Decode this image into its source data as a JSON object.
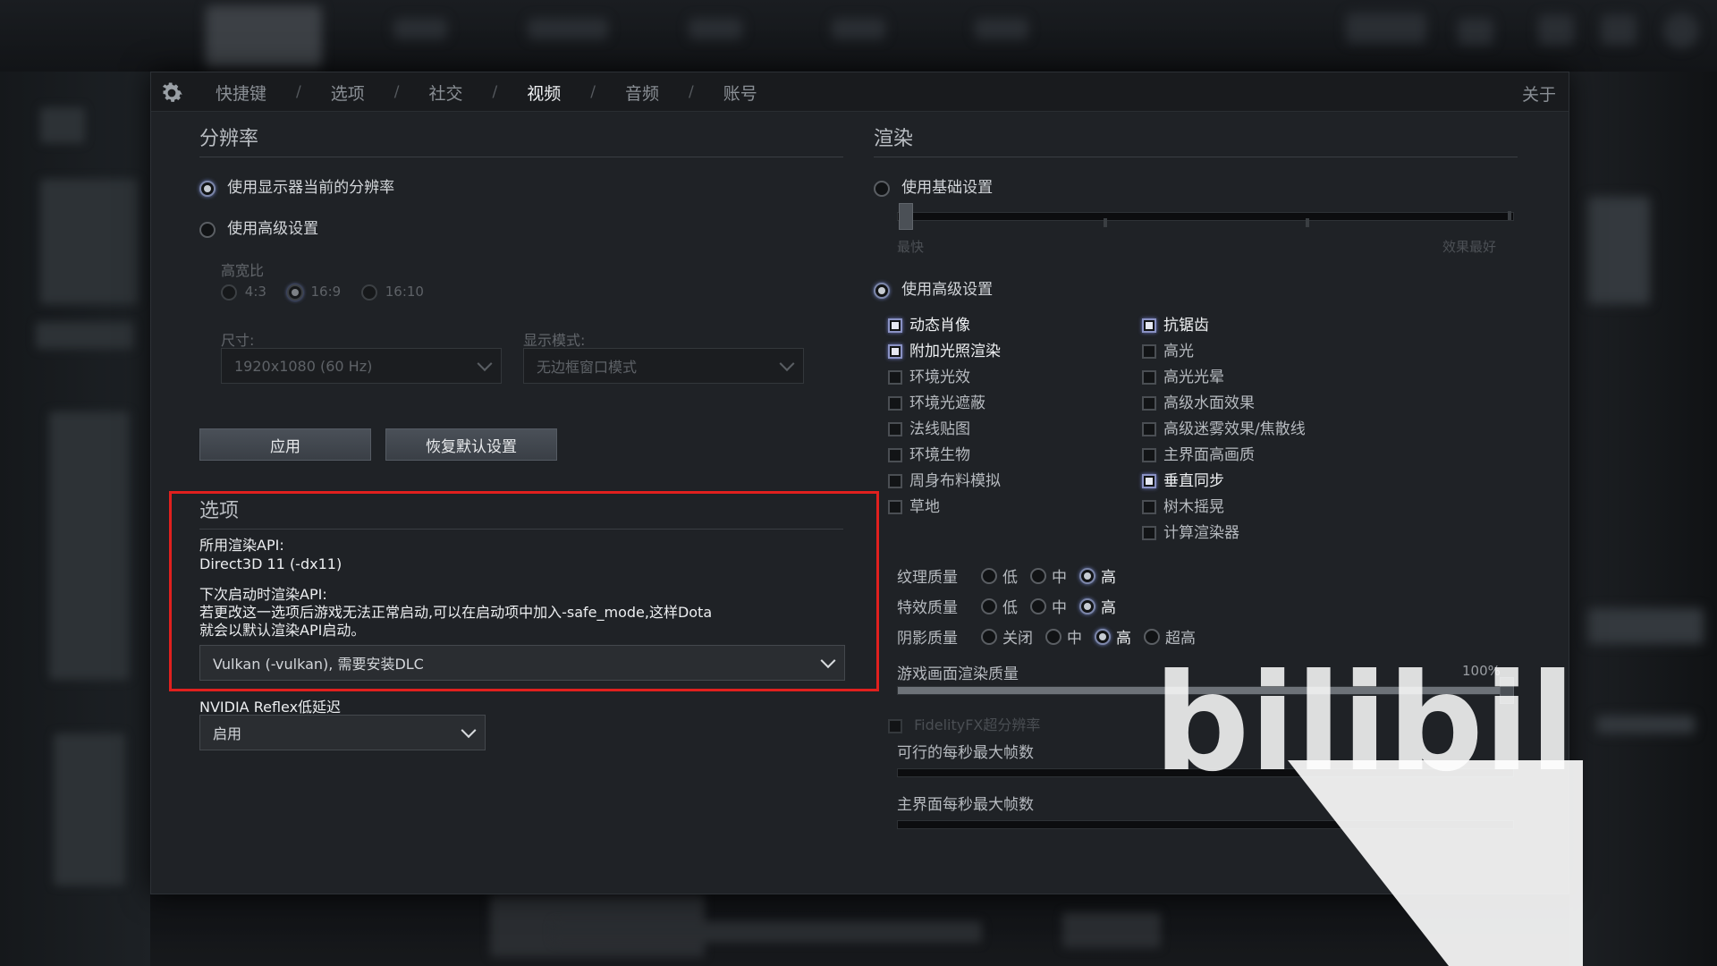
{
  "tabs": [
    "快捷键",
    "选项",
    "社交",
    "视频",
    "音频",
    "账号"
  ],
  "tab_separator": "/",
  "active_tab": "视频",
  "about": "关于",
  "resolution": {
    "title": "分辨率",
    "use_monitor": "使用显示器当前的分辨率",
    "use_advanced": "使用高级设置",
    "aspect_label": "高宽比",
    "aspect_options": [
      "4:3",
      "16:9",
      "16:10"
    ],
    "aspect_selected": "16:9",
    "size_label": "尺寸:",
    "size_value": "1920x1080 (60 Hz)",
    "display_mode_label": "显示模式:",
    "display_mode_value": "无边框窗口模式",
    "apply_button": "应用",
    "restore_button": "恢复默认设置"
  },
  "options": {
    "title": "选项",
    "api_label": "所用渲染API:",
    "api_value": "Direct3D 11 (-dx11)",
    "next_api_label": "下次启动时渲染API:",
    "next_api_note_1": "若更改这一选项后游戏无法正常启动,可以在启动项中加入-safe_mode,这样Dota",
    "next_api_note_2": "就会以默认渲染API启动。",
    "api_select": "Vulkan (-vulkan), 需要安装DLC",
    "reflex_label": "NVIDIA Reflex低延迟",
    "reflex_value": "启用"
  },
  "render": {
    "title": "渲染",
    "use_basic": "使用基础设置",
    "slider_left": "最快",
    "slider_right": "效果最好",
    "use_advanced": "使用高级设置",
    "left_checks": [
      {
        "label": "动态肖像",
        "checked": true
      },
      {
        "label": "附加光照渲染",
        "checked": true
      },
      {
        "label": "环境光效",
        "checked": false
      },
      {
        "label": "环境光遮蔽",
        "checked": false
      },
      {
        "label": "法线贴图",
        "checked": false
      },
      {
        "label": "环境生物",
        "checked": false
      },
      {
        "label": "周身布料模拟",
        "checked": false
      },
      {
        "label": "草地",
        "checked": false
      }
    ],
    "right_checks": [
      {
        "label": "抗锯齿",
        "checked": true
      },
      {
        "label": "高光",
        "checked": false
      },
      {
        "label": "高光光晕",
        "checked": false
      },
      {
        "label": "高级水面效果",
        "checked": false
      },
      {
        "label": "高级迷雾效果/焦散线",
        "checked": false
      },
      {
        "label": "主界面高画质",
        "checked": false
      },
      {
        "label": "垂直同步",
        "checked": true
      },
      {
        "label": "树木摇晃",
        "checked": false
      },
      {
        "label": "计算渲染器",
        "checked": false
      }
    ],
    "texture": {
      "label": "纹理质量",
      "options": [
        "低",
        "中",
        "高"
      ],
      "selected": "高"
    },
    "effects": {
      "label": "特效质量",
      "options": [
        "低",
        "中",
        "高"
      ],
      "selected": "高"
    },
    "shadow": {
      "label": "阴影质量",
      "options": [
        "关闭",
        "中",
        "高",
        "超高"
      ],
      "selected": "高"
    },
    "game_quality_label": "游戏画面渲染质量",
    "game_quality_value": "100%",
    "game_quality_fraction": 1.0,
    "fsr_label": "FidelityFX超分辨率",
    "max_fps_label": "可行的每秒最大帧数",
    "menu_fps_label": "主界面每秒最大帧数"
  },
  "watermark": "bilibili"
}
